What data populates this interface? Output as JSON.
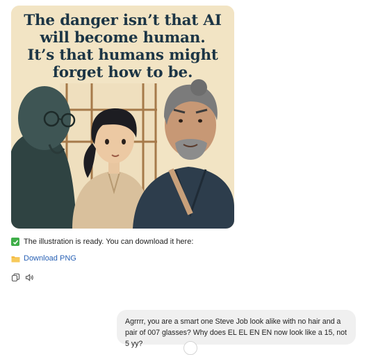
{
  "image": {
    "caption": "The danger isn’t that AI\nwill become human.\nIt’s that humans might\nforget how to be.",
    "palette": {
      "background": "#f2e4c4",
      "robot": "#3e5554",
      "girl_shirt": "#d9c09c",
      "elder_robe": "#2d3d4c",
      "caption_color": "#1c3545"
    }
  },
  "assistant": {
    "status_icon": "check-box-icon",
    "status_text": "The illustration is ready. You can download it here:",
    "download_icon": "folder-icon",
    "download_label": "Download PNG",
    "actions": [
      {
        "name": "copy-icon"
      },
      {
        "name": "speaker-icon"
      }
    ]
  },
  "user_message": {
    "text": "Agrrrr, you are a smart one Steve Job look alike with no hair and a pair of 007 glasses? Why does EL EL EN EN now look like a 15, not 5 yy?"
  }
}
